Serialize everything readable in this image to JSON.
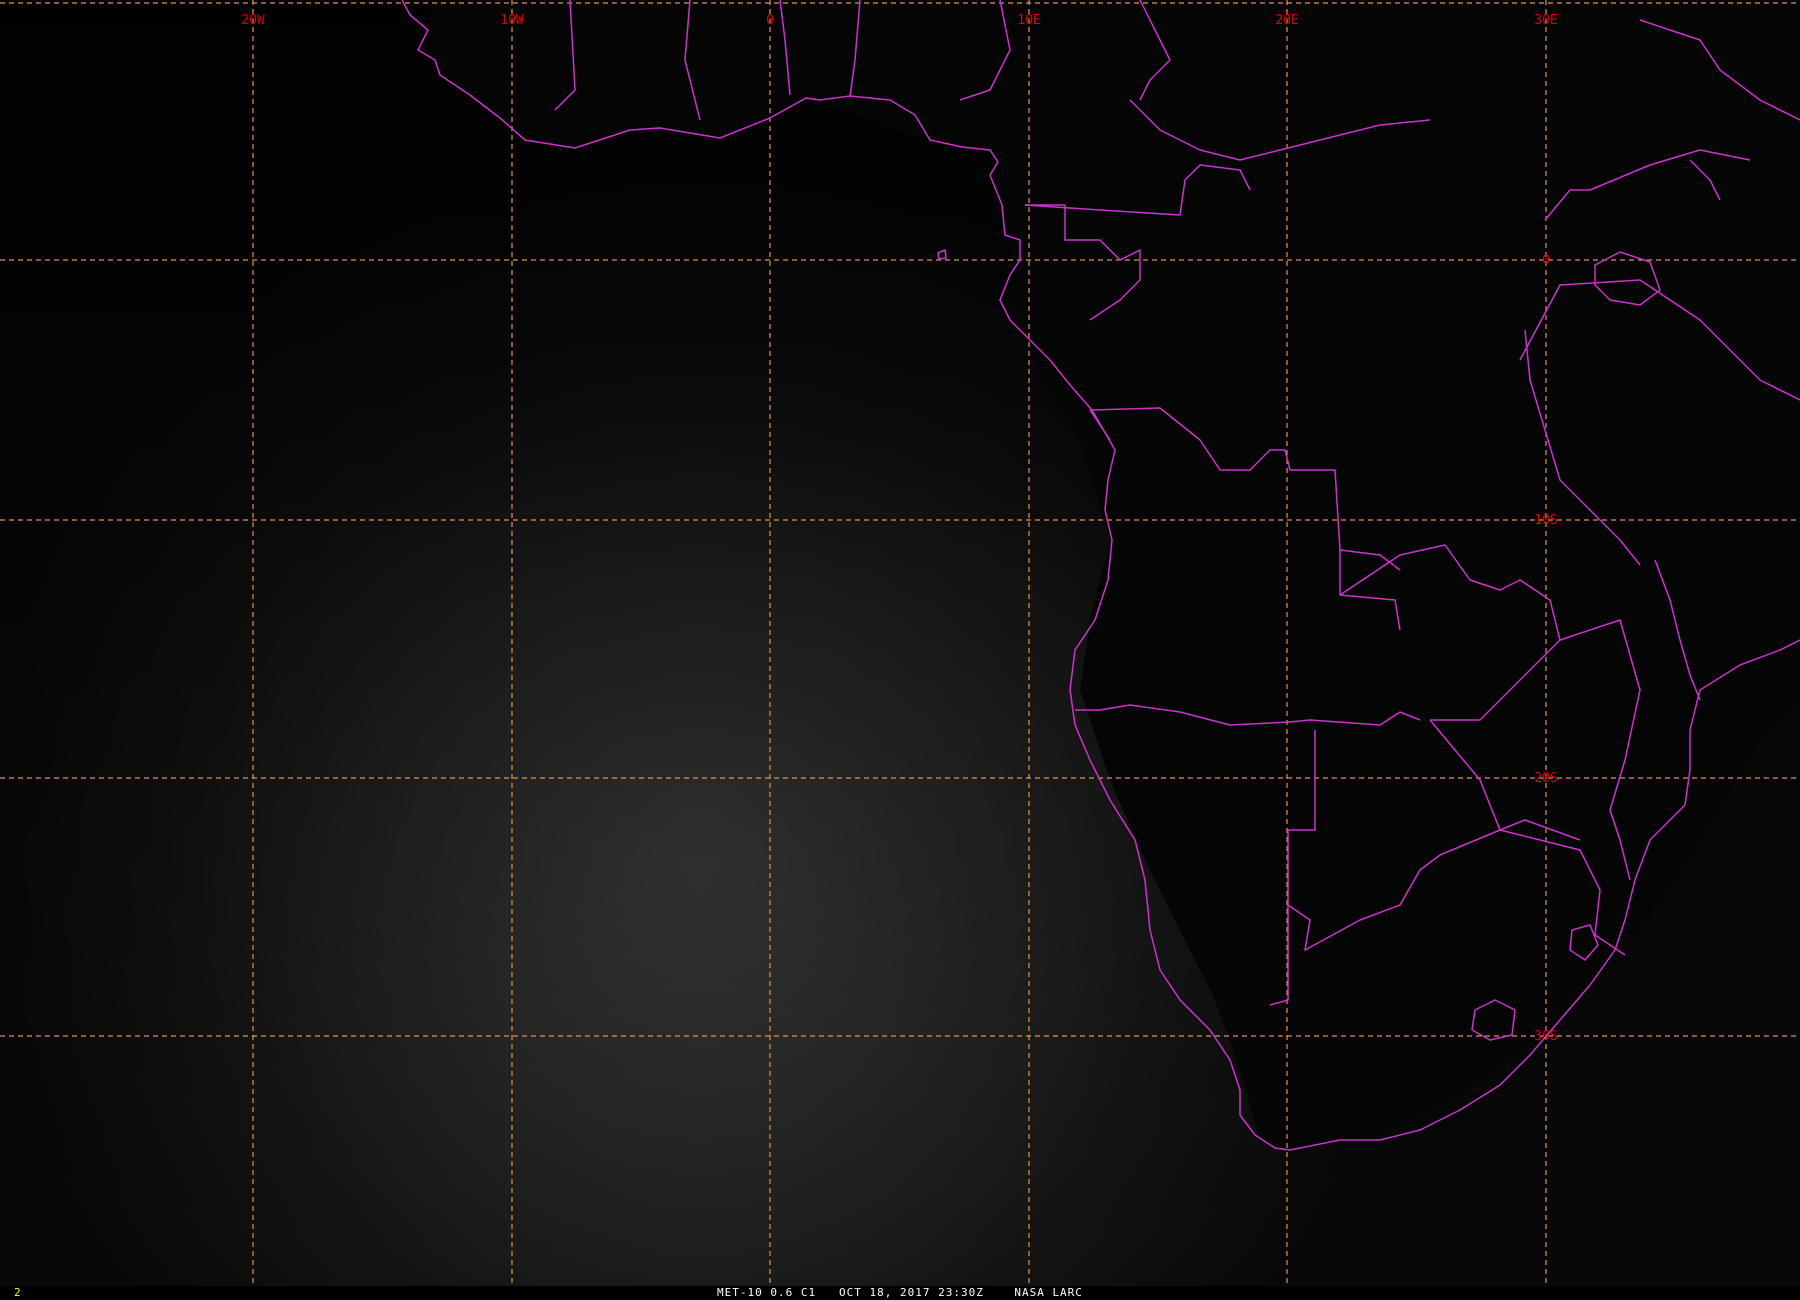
{
  "map": {
    "longitude_labels": [
      "20W",
      "10W",
      "0",
      "10E",
      "20E",
      "30E"
    ],
    "latitude_labels": [
      "0",
      "10S",
      "20S",
      "30S"
    ],
    "colors": {
      "background": "#000000",
      "grid_line": "#e0944a",
      "grid_label": "#e00000",
      "border": "#cc33cc",
      "frame_number": "#ffff33",
      "caption_text": "#ffffff"
    }
  },
  "status_bar": {
    "frame_number": "2",
    "caption": "MET-10 0.6 C1   OCT 18, 2017 23:30Z    NASA LARC"
  }
}
